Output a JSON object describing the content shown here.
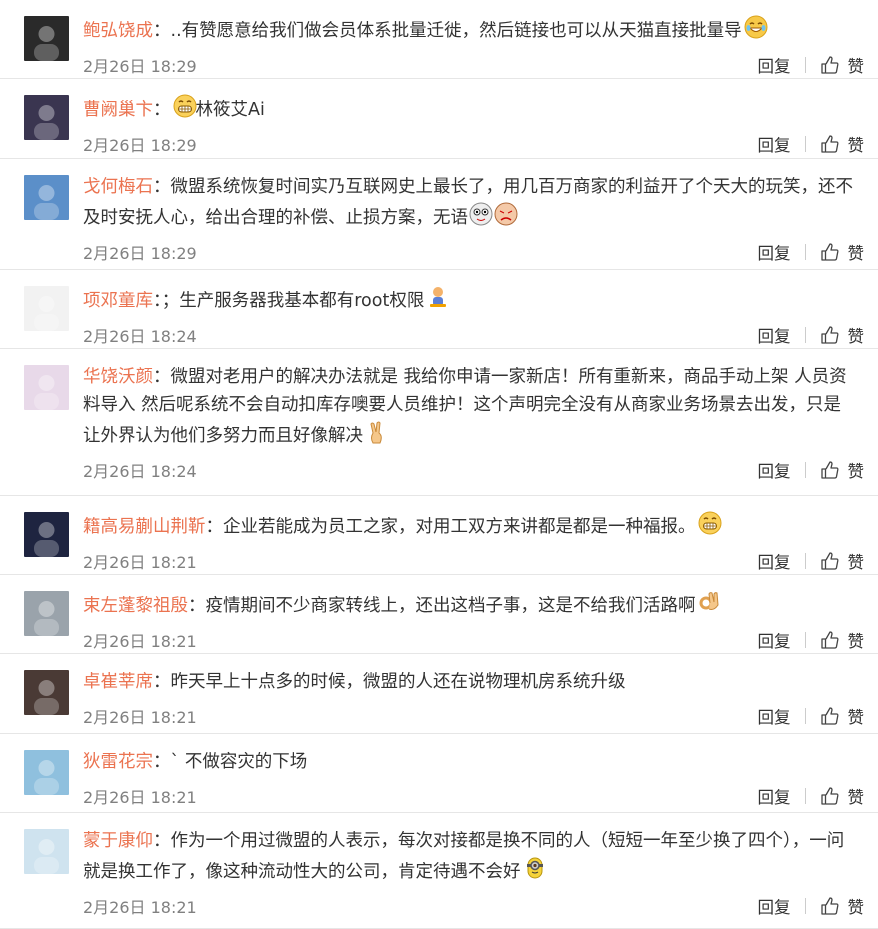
{
  "actions": {
    "reply_label": "回复",
    "like_label": "赞"
  },
  "comments": [
    {
      "name": "鲍弘饶成",
      "text": "..有赞愿意给我们做会员体系批量迁徙，然后链接也可以从天猫直接批量导",
      "emoji": "laugh",
      "time": "2月26日 18:29",
      "avatar_color": "#2a2a2a"
    },
    {
      "name": "曹阙巢卞",
      "text": "林筱艾Ai",
      "emoji_before": "grin",
      "time": "2月26日 18:29",
      "avatar_color": "#3a3550"
    },
    {
      "name": "戈何梅石",
      "text": "微盟系统恢复时间实乃互联网史上最长了，用几百万商家的利益开了个天大的玩笑，还不及时安抚人心，给出合理的补偿、止损方案，无语",
      "emoji": "faces",
      "time": "2月26日 18:29",
      "avatar_color": "#5b8fc9"
    },
    {
      "name": "项邓童库",
      "text": "；生产服务器我基本都有root权限",
      "emoji": "figure",
      "time": "2月26日 18:24",
      "avatar_color": "#f2f2f2"
    },
    {
      "name": "华饶沃颜",
      "text": "微盟对老用户的解决办法就是 我给你申请一家新店！所有重新来，商品手动上架 人员资料导入 然后呢系统不会自动扣库存噢要人员维护！这个声明完全没有从商家业务场景去出发，只是让外界认为他们多努力而且好像解决",
      "emoji": "victory",
      "time": "2月26日 18:24",
      "avatar_color": "#e8d9e9"
    },
    {
      "name": "籍高易蒯山荆靳",
      "text": "企业若能成为员工之家，对用工双方来讲都是都是一种福报。",
      "emoji": "grin",
      "time": "2月26日 18:21",
      "avatar_color": "#1e2440"
    },
    {
      "name": "束左蓬黎祖殷",
      "text": "疫情期间不少商家转线上，还出这档子事，这是不给我们活路啊",
      "emoji": "ok",
      "time": "2月26日 18:21",
      "avatar_color": "#9aa3ab"
    },
    {
      "name": "卓崔莘席",
      "text": "昨天早上十点多的时候，微盟的人还在说物理机房系统升级",
      "time": "2月26日 18:21",
      "avatar_color": "#4a3a35"
    },
    {
      "name": "狄雷花宗",
      "text": "` 不做容灾的下场",
      "time": "2月26日 18:21",
      "avatar_color": "#8fc0de"
    },
    {
      "name": "蒙于康仰",
      "text": "作为一个用过微盟的人表示，每次对接都是换不同的人（短短一年至少换了四个），一问就是换工作了，像这种流动性大的公司，肯定待遇不会好",
      "emoji": "minion",
      "time": "2月26日 18:21",
      "avatar_color": "#cfe3ef"
    }
  ]
}
